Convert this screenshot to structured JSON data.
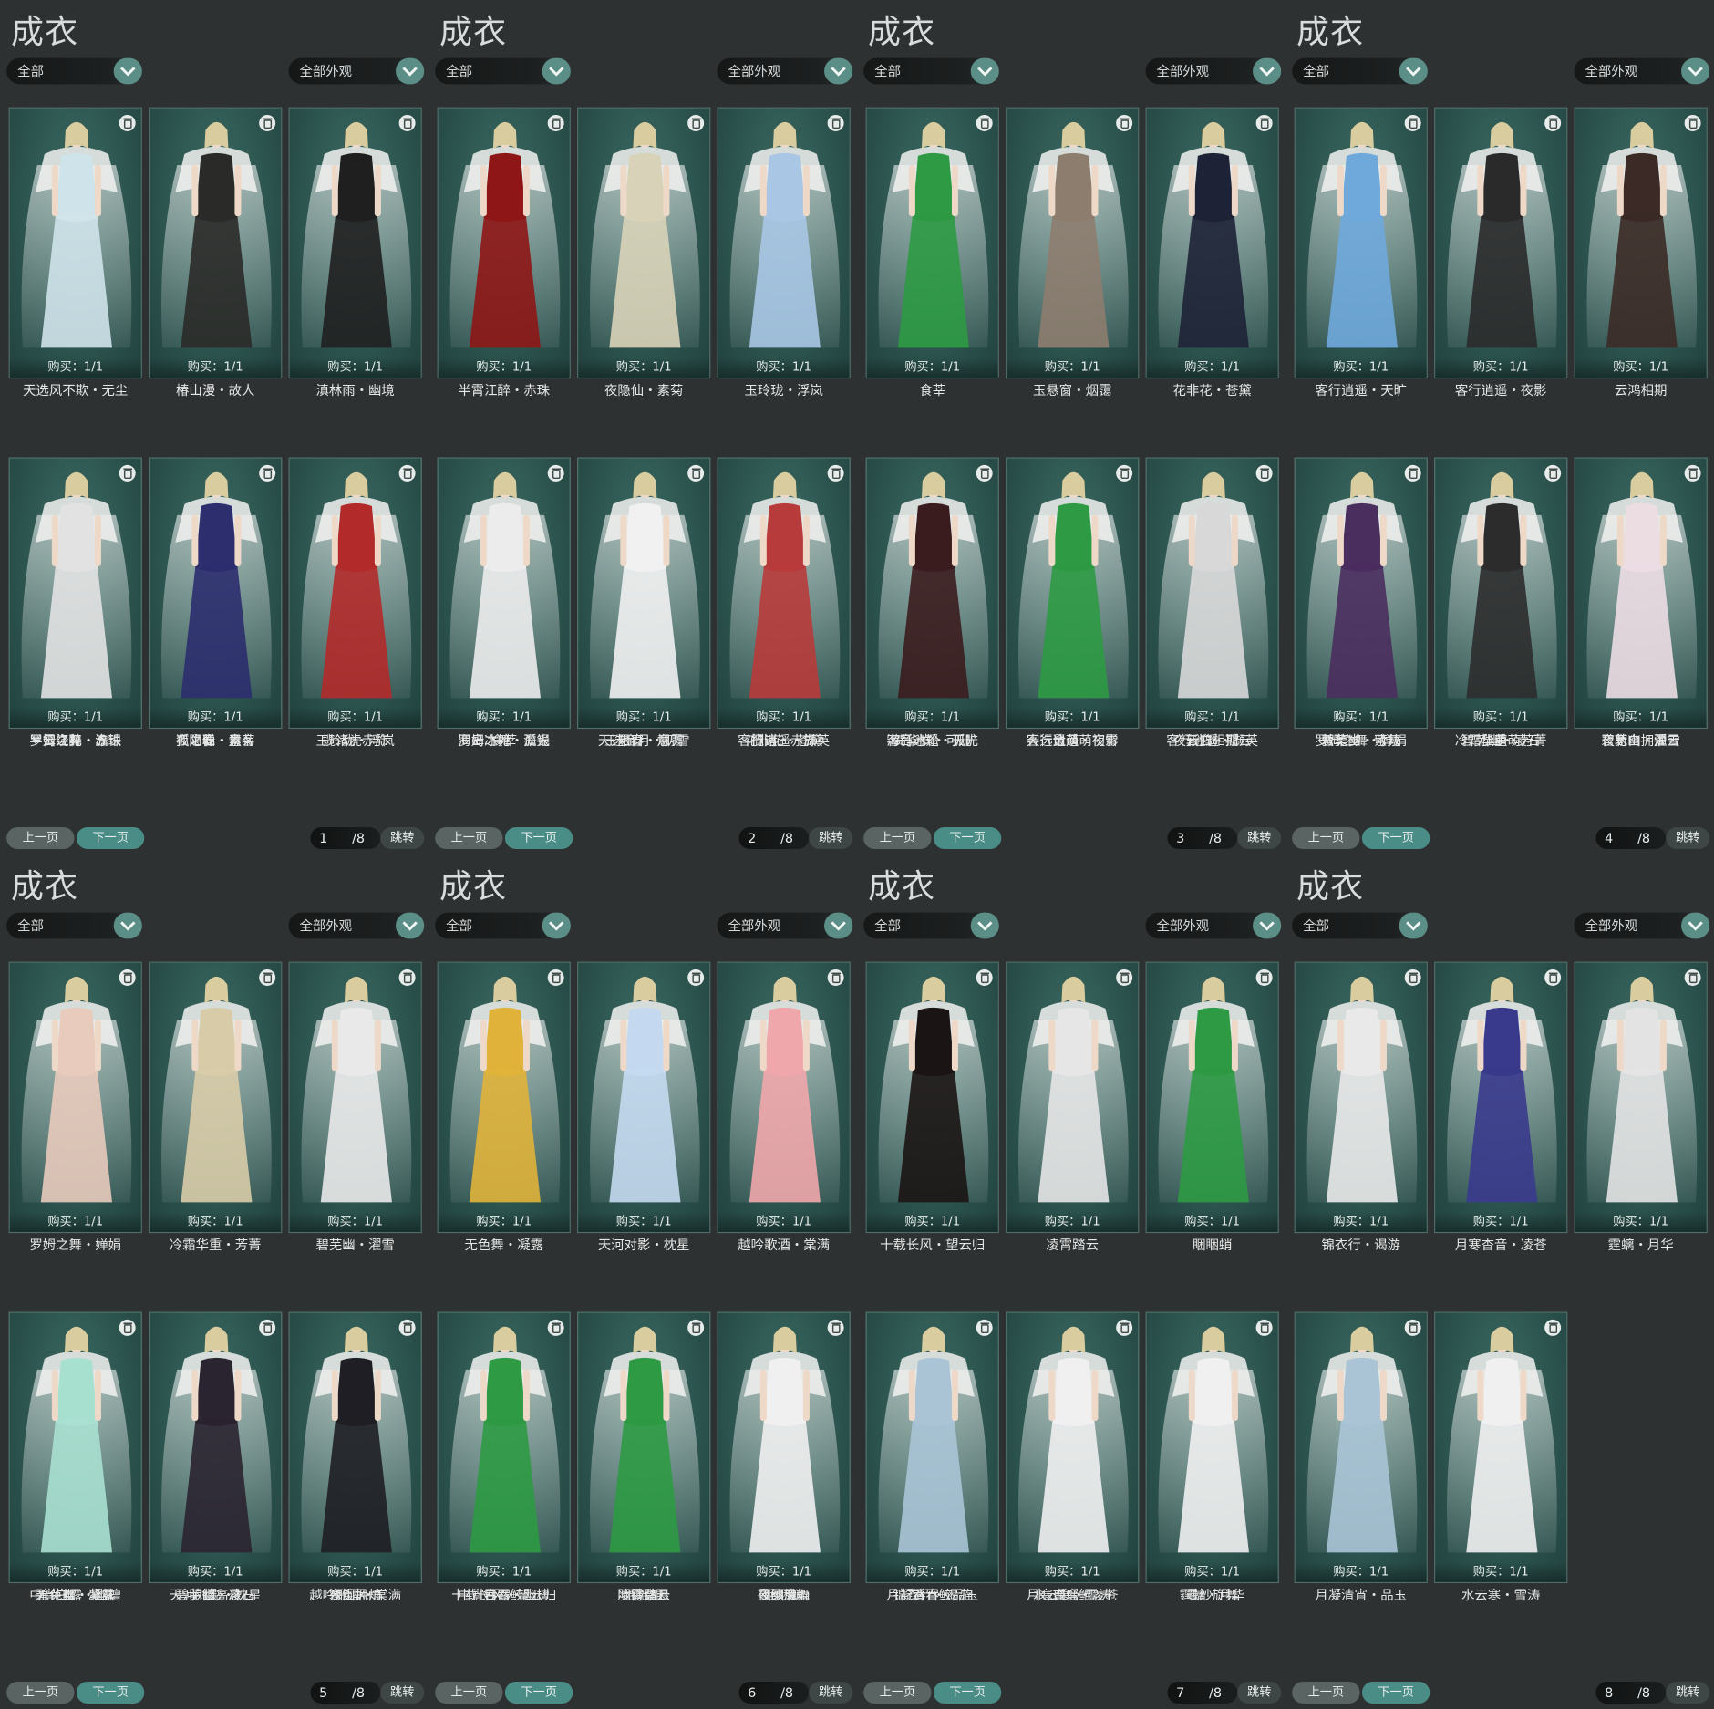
{
  "colors": {
    "background": "#2e3131",
    "card": "#2d5550",
    "accent": "#4a8d86",
    "text": "#e6e8e8"
  },
  "panels": [
    {
      "title": "成衣",
      "filter_all": "全部",
      "filter_appearance": "全部外观",
      "prev": "上一页",
      "next": "下一页",
      "page": "1",
      "total": "/8",
      "jump": "跳转",
      "items": [
        {
          "name": "天选风不欺・无尘",
          "buy": "购买：1/1",
          "hue": "#cfe3ea"
        },
        {
          "name": "椿山漫・故人",
          "buy": "购买：1/1",
          "hue": "#2a2a28"
        },
        {
          "name": "滇林雨・幽境",
          "buy": "购买：1/1",
          "hue": "#1f1f1f"
        },
        {
          "name": "半霄江醉・赤珠",
          "buy": "购买：1/1",
          "hue": "#8e1616"
        },
        {
          "name": "夜隐仙・素菊",
          "buy": "购买：1/1",
          "hue": "#d8d3b8"
        },
        {
          "name": "玉玲珑・浮岚",
          "buy": "购买：1/1",
          "hue": "#a9c6e4"
        },
        {
          "name": "云绕花・五",
          "buy": "购买：1/1",
          "hue": "#2e9a44"
        },
        {
          "name": "狐之聪・墨客",
          "buy": "购买：1/1",
          "hue": "#2e9a44"
        },
        {
          "name": "虎",
          "buy": "购买：1/1",
          "hue": "#2e9a44"
        },
        {
          "name": "罗姆之舞・澹银",
          "buy": "购买：1/1",
          "hue": "#e2e2e2"
        },
        {
          "name": "阳春・意",
          "buy": "购买：1/1",
          "hue": "#2c2e6e"
        },
        {
          "name": "揽诸・赤旆",
          "buy": "购买：1/1",
          "hue": "#b32a2a"
        }
      ]
    },
    {
      "title": "成衣",
      "filter_all": "全部",
      "filter_appearance": "全部外观",
      "prev": "上一页",
      "next": "下一页",
      "page": "2",
      "total": "/8",
      "jump": "跳转",
      "items": [
        {
          "name": "半霄江醉・赤珠",
          "buy": "购买：1/1",
          "hue": "#8e1616"
        },
        {
          "name": "夜隐仙・素菊",
          "buy": "购买：1/1",
          "hue": "#d8d3b8"
        },
        {
          "name": "玉玲珑・浮岚",
          "buy": "购买：1/1",
          "hue": "#a9c6e4"
        },
        {
          "name": "食莘",
          "buy": "购买：1/1",
          "hue": "#2e9a44"
        },
        {
          "name": "玉悬窗・烟霭",
          "buy": "购买：1/1",
          "hue": "#8d7d6f"
        },
        {
          "name": "花非花・苍黛",
          "buy": "购买：1/1",
          "hue": "#1e2236"
        },
        {
          "name": "罗姆之舞・澹银",
          "buy": "购买：1/1",
          "hue": "#e2e2e2"
        },
        {
          "name": "阳春・意",
          "buy": "购买：1/1",
          "hue": "#2c2e6e"
        },
        {
          "name": "揽诸・赤旆",
          "buy": "购买：1/1",
          "hue": "#b32a2a"
        },
        {
          "name": "海岛冰轮・孤光",
          "buy": "购买：1/1",
          "hue": "#ececec"
        },
        {
          "name": "天选金月・初雪",
          "buy": "购买：1/1",
          "hue": "#f1f1f1"
        },
        {
          "name": "客行逍遥・撷英",
          "buy": "购买：1/1",
          "hue": "#b83b3b"
        }
      ]
    },
    {
      "title": "成衣",
      "filter_all": "全部",
      "filter_appearance": "全部外观",
      "prev": "上一页",
      "next": "下一页",
      "page": "3",
      "total": "/8",
      "jump": "跳转",
      "items": [
        {
          "name": "食莘",
          "buy": "购买：1/1",
          "hue": "#2e9a44"
        },
        {
          "name": "玉悬窗・烟霭",
          "buy": "购买：1/1",
          "hue": "#8d7d6f"
        },
        {
          "name": "花非花・苍黛",
          "buy": "购买：1/1",
          "hue": "#1e2236"
        },
        {
          "name": "客行逍遥・天旷",
          "buy": "购买：1/1",
          "hue": "#6fa9dc"
        },
        {
          "name": "客行逍遥・夜影",
          "buy": "购买：1/1",
          "hue": "#2a2a2a"
        },
        {
          "name": "云鸿相期",
          "buy": "购买：1/1",
          "hue": "#3b2a26"
        },
        {
          "name": "海岛冰轮・孤光",
          "buy": "购买：1/1",
          "hue": "#ececec"
        },
        {
          "name": "天选金月・初雪",
          "buy": "购买：1/1",
          "hue": "#f1f1f1"
        },
        {
          "name": "客行逍遥・撷英",
          "buy": "购买：1/1",
          "hue": "#b83b3b"
        },
        {
          "name": "贺华岁・可儿",
          "buy": "购买：1/1",
          "hue": "#3b1c1e"
        },
        {
          "name": "鼠萌萌",
          "buy": "购买：1/1",
          "hue": "#2e9a44"
        },
        {
          "name": "夜斩白・孤云",
          "buy": "购买：1/1",
          "hue": "#d8d8d8"
        }
      ]
    },
    {
      "title": "成衣",
      "filter_all": "全部",
      "filter_appearance": "全部外观",
      "prev": "上一页",
      "next": "下一页",
      "page": "4",
      "total": "/8",
      "jump": "跳转",
      "items": [
        {
          "name": "客行逍遥・天旷",
          "buy": "购买：1/1",
          "hue": "#6fa9dc"
        },
        {
          "name": "客行逍遥・夜影",
          "buy": "购买：1/1",
          "hue": "#2a2a2a"
        },
        {
          "name": "云鸿相期",
          "buy": "购买：1/1",
          "hue": "#3b2a26"
        },
        {
          "name": "罗姆之舞・婵娟",
          "buy": "购买：1/1",
          "hue": "#e8cbbd"
        },
        {
          "name": "冷霜华重・芳菁",
          "buy": "购买：1/1",
          "hue": "#d8cca8"
        },
        {
          "name": "碧芜幽・濯雪",
          "buy": "购买：1/1",
          "hue": "#e9e9e9"
        },
        {
          "name": "贺华岁・可儿",
          "buy": "购买：1/1",
          "hue": "#3b1c1e"
        },
        {
          "name": "鼠萌萌",
          "buy": "购买：1/1",
          "hue": "#2e9a44"
        },
        {
          "name": "夜斩白・孤云",
          "buy": "购买：1/1",
          "hue": "#d8d8d8"
        },
        {
          "name": "碧芜幽・紫氛",
          "buy": "购买：1/1",
          "hue": "#4a2e5e"
        },
        {
          "name": "碧芜幽・凌石",
          "buy": "购买：1/1",
          "hue": "#2c2c2c"
        },
        {
          "name": "寒山拥炉",
          "buy": "购买：1/1",
          "hue": "#ecdde3"
        }
      ]
    },
    {
      "title": "成衣",
      "filter_all": "全部",
      "filter_appearance": "全部外观",
      "prev": "上一页",
      "next": "下一页",
      "page": "5",
      "total": "/8",
      "jump": "跳转",
      "items": [
        {
          "name": "罗姆之舞・婵娟",
          "buy": "购买：1/1",
          "hue": "#e8cbbd"
        },
        {
          "name": "冷霜华重・芳菁",
          "buy": "购买：1/1",
          "hue": "#d8cca8"
        },
        {
          "name": "碧芜幽・濯雪",
          "buy": "购买：1/1",
          "hue": "#e9e9e9"
        },
        {
          "name": "无色舞・凝露",
          "buy": "购买：1/1",
          "hue": "#e0b23a"
        },
        {
          "name": "天河对影・枕星",
          "buy": "购买：1/1",
          "hue": "#c4d9ef"
        },
        {
          "name": "越吟歌酒・棠满",
          "buy": "购买：1/1",
          "hue": "#f0a7ab"
        },
        {
          "name": "碧芜幽・紫氛",
          "buy": "购买：1/1",
          "hue": "#4a2e5e"
        },
        {
          "name": "碧芜幽・凌石",
          "buy": "购买：1/1",
          "hue": "#2c2c2c"
        },
        {
          "name": "寒山拥炉",
          "buy": "购买：1/1",
          "hue": "#ecdde3"
        },
        {
          "name": "中宵白露・幽檀",
          "buy": "购买：1/1",
          "hue": "#a8e0d0"
        },
        {
          "name": "明镜高悬",
          "buy": "购买：1/1",
          "hue": "#2a2430"
        },
        {
          "name": "夜阑风雨",
          "buy": "购买：1/1",
          "hue": "#1e1e24"
        }
      ]
    },
    {
      "title": "成衣",
      "filter_all": "全部",
      "filter_appearance": "全部外观",
      "prev": "上一页",
      "next": "下一页",
      "page": "6",
      "total": "/8",
      "jump": "跳转",
      "items": [
        {
          "name": "无色舞・凝露",
          "buy": "购买：1/1",
          "hue": "#e0b23a"
        },
        {
          "name": "天河对影・枕星",
          "buy": "购买：1/1",
          "hue": "#c4d9ef"
        },
        {
          "name": "越吟歌酒・棠满",
          "buy": "购买：1/1",
          "hue": "#f0a7ab"
        },
        {
          "name": "十载长风・望云归",
          "buy": "购买：1/1",
          "hue": "#1b1414"
        },
        {
          "name": "凌霄踏云",
          "buy": "购买：1/1",
          "hue": "#e6e6e6"
        },
        {
          "name": "睏睏蛸",
          "buy": "购买：1/1",
          "hue": "#2e9a44"
        },
        {
          "name": "中宵白露・幽檀",
          "buy": "购买：1/1",
          "hue": "#a8e0d0"
        },
        {
          "name": "明镜高悬",
          "buy": "购买：1/1",
          "hue": "#2a2430"
        },
        {
          "name": "夜阑风雨",
          "buy": "购买：1/1",
          "hue": "#1e1e24"
        },
        {
          "name": "吞吞鲛",
          "buy": "购买：1/1",
          "hue": "#2e9a44"
        },
        {
          "name": "瑶瑶鲲",
          "buy": "购买：1/1",
          "hue": "#2e9a44"
        },
        {
          "name": "曼纱旋舞",
          "buy": "购买：1/1",
          "hue": "#f0f0f0"
        }
      ]
    },
    {
      "title": "成衣",
      "filter_all": "全部",
      "filter_appearance": "全部外观",
      "prev": "上一页",
      "next": "下一页",
      "page": "7",
      "total": "/8",
      "jump": "跳转",
      "items": [
        {
          "name": "十载长风・望云归",
          "buy": "购买：1/1",
          "hue": "#1b1414"
        },
        {
          "name": "凌霄踏云",
          "buy": "购买：1/1",
          "hue": "#e6e6e6"
        },
        {
          "name": "睏睏蛸",
          "buy": "购买：1/1",
          "hue": "#2e9a44"
        },
        {
          "name": "锦衣行・谒游",
          "buy": "购买：1/1",
          "hue": "#e9e9e9"
        },
        {
          "name": "月寒杳音・凌苍",
          "buy": "购买：1/1",
          "hue": "#3a3a8c"
        },
        {
          "name": "霆螭・月华",
          "buy": "购买：1/1",
          "hue": "#e3e3e3"
        },
        {
          "name": "吞吞鲛",
          "buy": "购买：1/1",
          "hue": "#2e9a44"
        },
        {
          "name": "瑶瑶鲲",
          "buy": "购买：1/1",
          "hue": "#2e9a44"
        },
        {
          "name": "曼纱旋舞",
          "buy": "购买：1/1",
          "hue": "#f0f0f0"
        },
        {
          "name": "月凝清宵・品玉",
          "buy": "购买：1/1",
          "hue": "#aac4d6"
        },
        {
          "name": "水云寒・雪涛",
          "buy": "购买：1/1",
          "hue": "#f0f0f0"
        }
      ]
    },
    {
      "title": "成衣",
      "filter_all": "全部",
      "filter_appearance": "全部外观",
      "prev": "上一页",
      "next": "下一页",
      "page": "8",
      "total": "/8",
      "jump": "跳转",
      "items": [
        {
          "name": "锦衣行・谒游",
          "buy": "购买：1/1",
          "hue": "#e9e9e9"
        },
        {
          "name": "月寒杳音・凌苍",
          "buy": "购买：1/1",
          "hue": "#3a3a8c"
        },
        {
          "name": "霆螭・月华",
          "buy": "购买：1/1",
          "hue": "#e3e3e3"
        },
        {
          "name": "月凝清宵・品玉",
          "buy": "购买：1/1",
          "hue": "#aac4d6"
        },
        {
          "name": "水云寒・雪涛",
          "buy": "购买：1/1",
          "hue": "#f0f0f0"
        }
      ]
    }
  ]
}
